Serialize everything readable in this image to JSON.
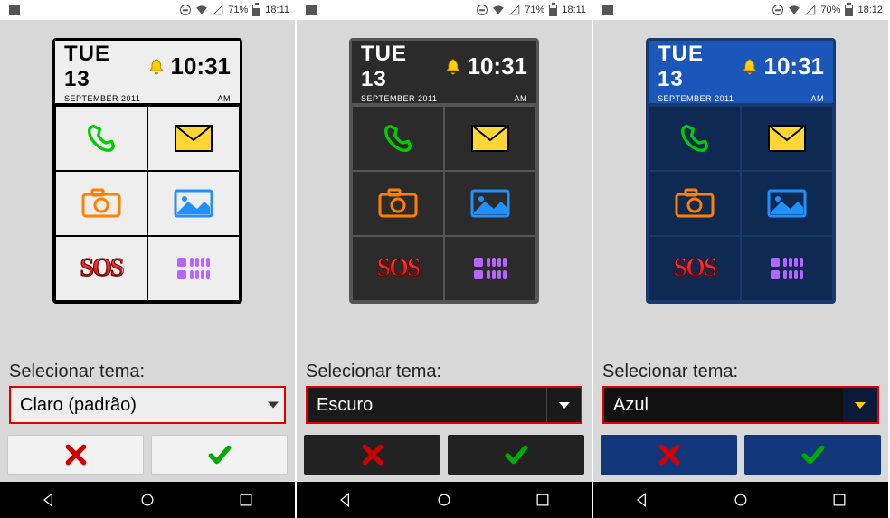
{
  "screens": [
    {
      "theme": "light",
      "status": {
        "battery": "71%",
        "time": "18:11"
      },
      "clock": {
        "day": "TUE 13",
        "time": "10:31",
        "month": "SEPTEMBER 2011",
        "ampm": "AM"
      },
      "selector_label": "Selecionar tema:",
      "selected_theme": "Claro (padrão)"
    },
    {
      "theme": "dark",
      "status": {
        "battery": "71%",
        "time": "18:11"
      },
      "clock": {
        "day": "TUE 13",
        "time": "10:31",
        "month": "SEPTEMBER 2011",
        "ampm": "AM"
      },
      "selector_label": "Selecionar tema:",
      "selected_theme": "Escuro"
    },
    {
      "theme": "blue",
      "status": {
        "battery": "70%",
        "time": "18:12"
      },
      "clock": {
        "day": "TUE 13",
        "time": "10:31",
        "month": "SEPTEMBER 2011",
        "ampm": "AM"
      },
      "selector_label": "Selecionar tema:",
      "selected_theme": "Azul"
    }
  ],
  "tile_icons": [
    "phone",
    "mail",
    "camera",
    "picture",
    "sos",
    "apps"
  ],
  "nav_icons": [
    "back",
    "home",
    "recent"
  ]
}
